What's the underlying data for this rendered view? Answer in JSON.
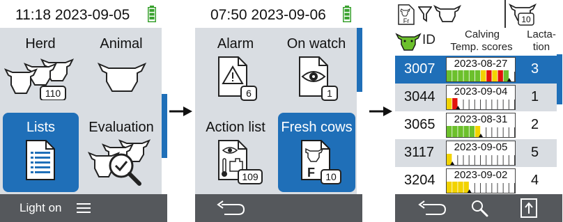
{
  "screens": [
    {
      "time": "11:18 2023-09-05",
      "tiles": [
        {
          "label": "Herd",
          "badge": "110",
          "icon": "herd-icon"
        },
        {
          "label": "Animal",
          "badge": "",
          "icon": "cow-head-icon"
        },
        {
          "label": "Lists",
          "badge": "",
          "icon": "document-list-icon"
        },
        {
          "label": "Evaluation",
          "badge": "",
          "icon": "herd-search-check-icon"
        }
      ],
      "footer": {
        "light_label": "Light on",
        "menu_icon": "hamburger-menu-icon"
      }
    },
    {
      "time": "07:50 2023-09-06",
      "tiles": [
        {
          "label": "Alarm",
          "badge": "6",
          "icon": "warning-triangle-icon"
        },
        {
          "label": "On watch",
          "badge": "1",
          "icon": "eye-icon"
        },
        {
          "label": "Action list",
          "badge": "109",
          "icon": "action-list-icon"
        },
        {
          "label": "Fresh cows",
          "badge": "10",
          "icon": "fresh-cow-icon"
        }
      ],
      "footer": {
        "back_icon": "back-arrow-icon"
      }
    },
    {
      "status": {
        "fr_label": "Fr",
        "filter_icon": "filter-icon",
        "count": "10"
      },
      "header": {
        "id": "ID",
        "calving_line1": "Calving",
        "calving_line2": "Temp. scores",
        "lactation_line1": "Lacta-",
        "lactation_line2": "tion"
      },
      "rows": [
        {
          "id": "3007",
          "date": "2023-08-27",
          "lactation": "3",
          "scores": [
            1,
            1,
            1,
            1,
            1,
            1,
            2,
            3,
            2,
            3,
            1,
            0
          ],
          "selected": true
        },
        {
          "id": "3044",
          "date": "2023-09-04",
          "lactation": "1",
          "scores": [
            2,
            3,
            0,
            0,
            0,
            0,
            0,
            0,
            0,
            0,
            0,
            0
          ],
          "selected": false
        },
        {
          "id": "3065",
          "date": "2023-08-31",
          "lactation": "2",
          "scores": [
            1,
            1,
            1,
            1,
            1,
            2,
            0,
            0,
            0,
            0,
            0,
            0
          ],
          "selected": false
        },
        {
          "id": "3117",
          "date": "2023-09-05",
          "lactation": "5",
          "scores": [
            2,
            0,
            0,
            0,
            0,
            0,
            0,
            0,
            0,
            0,
            0,
            0
          ],
          "selected": false
        },
        {
          "id": "3204",
          "date": "2023-09-02",
          "lactation": "4",
          "scores": [
            2,
            2,
            2,
            2,
            0,
            0,
            0,
            0,
            0,
            0,
            0,
            0
          ],
          "selected": false
        }
      ],
      "footer": {
        "back_icon": "back-arrow-icon",
        "search_icon": "magnifier-icon",
        "export_icon": "export-icon"
      }
    }
  ],
  "colors": {
    "accent": "#1f6fb8",
    "panel": "#d9dde2",
    "footer": "#55585c",
    "battery": "#3aa22f",
    "score_green": "#6cc02c",
    "score_yellow": "#f2d300",
    "score_red": "#e3120b"
  }
}
